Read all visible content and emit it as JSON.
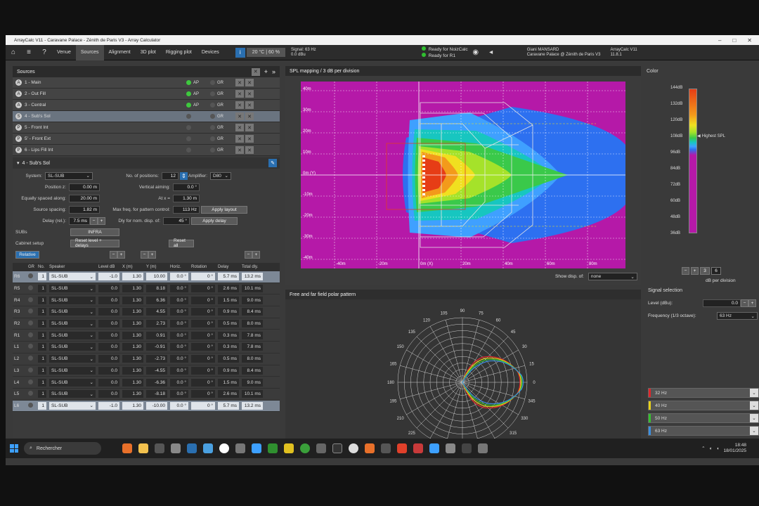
{
  "window": {
    "title": "ArrayCalc V11 - Caravane Palace - Zénith de Paris V3 - Array Calculator"
  },
  "toolbar": {
    "tabs": [
      "Venue",
      "Sources",
      "Alignment",
      "3D plot",
      "Rigging plot",
      "Devices"
    ],
    "active_tab": "Sources",
    "temperature": "20 °C | 60 %",
    "signal_line1": "Signal: 63 Hz",
    "signal_line2": "0.0 dBu",
    "status1": "Ready for NoizCalc",
    "status2": "Ready for R1",
    "user_line1": "Giani MANSARD",
    "user_line2": "Caravane Palace @ Zénith de Paris V3",
    "version_line1": "ArrayCalc V11",
    "version_line2": "11.8.1"
  },
  "sources": {
    "title": "Sources",
    "items": [
      {
        "letter": "A",
        "name": "1 - Main",
        "ap": true,
        "ap_label": "AP",
        "gr_label": "GR"
      },
      {
        "letter": "A",
        "name": "2 - Out Fill",
        "ap": true,
        "ap_label": "AP",
        "gr_label": "GR"
      },
      {
        "letter": "A",
        "name": "3 - Central",
        "ap": true,
        "ap_label": "AP",
        "gr_label": "GR"
      },
      {
        "letter": "S",
        "name": "4 - Sub's Sol",
        "ap": false,
        "ap_label": "",
        "gr_label": "GR"
      },
      {
        "letter": "P",
        "name": "5 - Front Int",
        "ap": false,
        "ap_label": "",
        "gr_label": "GR"
      },
      {
        "letter": "P",
        "name": "5' - Front Ext",
        "ap": false,
        "ap_label": "",
        "gr_label": "GR"
      },
      {
        "letter": "P",
        "name": "6 - Lips Fill Int",
        "ap": false,
        "ap_label": "",
        "gr_label": "GR"
      }
    ]
  },
  "sub": {
    "title": "4 - Sub's Sol",
    "system_label": "System:",
    "system_value": "SL-SUB",
    "positions_label": "No. of positions:",
    "positions_value": "12",
    "amplifier_label": "Amplifier:",
    "amplifier_value": "D80",
    "posz_label": "Position z:",
    "posz_value": "0.00 m",
    "vaim_label": "Vertical aiming:",
    "vaim_value": "0.0 °",
    "spaced_label": "Equally spaced along:",
    "spaced_value": "20.00 m",
    "atx_label": "At x =",
    "atx_value": "1.30 m",
    "spacing_label": "Source spacing:",
    "spacing_value": "1.82 m",
    "maxfreq_label": "Max freq. for pattern control:",
    "maxfreq_value": "113 Hz",
    "apply_layout": "Apply layout",
    "delay_label": "Delay (rel.):",
    "delay_value": "7.5 ms",
    "dly_label": "Dly for nom. disp. of:",
    "dly_value": "45 °",
    "apply_delay": "Apply delay",
    "subs_label": "SUBs",
    "infra_label": "INFRA",
    "cabinet_label": "Cabinet setup",
    "reset_level": "Reset level + delays",
    "reset_all": "Reset all",
    "relative_label": "Relative"
  },
  "table": {
    "headers": [
      "",
      "GR",
      "No.",
      "Speaker",
      "Level dB",
      "X (m)",
      "Y (m)",
      "Horiz.",
      "Rotation",
      "Delay",
      "Total dly."
    ],
    "rows": [
      {
        "id": "R6",
        "no": "1",
        "speaker": "SL-SUB",
        "level": "-1.0",
        "x": "1.30",
        "y": "10.00",
        "horiz": "0.0 °",
        "rot": "0 °",
        "delay": "5.7 ms",
        "total": "13.2 ms",
        "hl": true
      },
      {
        "id": "R5",
        "no": "1",
        "speaker": "SL-SUB",
        "level": "0.0",
        "x": "1.30",
        "y": "8.18",
        "horiz": "0.0 °",
        "rot": "0 °",
        "delay": "2.6 ms",
        "total": "10.1 ms",
        "hl": false
      },
      {
        "id": "R4",
        "no": "1",
        "speaker": "SL-SUB",
        "level": "0.0",
        "x": "1.30",
        "y": "6.36",
        "horiz": "0.0 °",
        "rot": "0 °",
        "delay": "1.5 ms",
        "total": "9.0 ms",
        "hl": false
      },
      {
        "id": "R3",
        "no": "1",
        "speaker": "SL-SUB",
        "level": "0.0",
        "x": "1.30",
        "y": "4.55",
        "horiz": "0.0 °",
        "rot": "0 °",
        "delay": "0.9 ms",
        "total": "8.4 ms",
        "hl": false
      },
      {
        "id": "R2",
        "no": "1",
        "speaker": "SL-SUB",
        "level": "0.0",
        "x": "1.30",
        "y": "2.73",
        "horiz": "0.0 °",
        "rot": "0 °",
        "delay": "0.5 ms",
        "total": "8.0 ms",
        "hl": false
      },
      {
        "id": "R1",
        "no": "1",
        "speaker": "SL-SUB",
        "level": "0.0",
        "x": "1.30",
        "y": "0.91",
        "horiz": "0.0 °",
        "rot": "0 °",
        "delay": "0.3 ms",
        "total": "7.8 ms",
        "hl": false
      },
      {
        "id": "L1",
        "no": "1",
        "speaker": "SL-SUB",
        "level": "0.0",
        "x": "1.30",
        "y": "-0.91",
        "horiz": "0.0 °",
        "rot": "0 °",
        "delay": "0.3 ms",
        "total": "7.8 ms",
        "hl": false
      },
      {
        "id": "L2",
        "no": "1",
        "speaker": "SL-SUB",
        "level": "0.0",
        "x": "1.30",
        "y": "-2.73",
        "horiz": "0.0 °",
        "rot": "0 °",
        "delay": "0.5 ms",
        "total": "8.0 ms",
        "hl": false
      },
      {
        "id": "L3",
        "no": "1",
        "speaker": "SL-SUB",
        "level": "0.0",
        "x": "1.30",
        "y": "-4.55",
        "horiz": "0.0 °",
        "rot": "0 °",
        "delay": "0.9 ms",
        "total": "8.4 ms",
        "hl": false
      },
      {
        "id": "L4",
        "no": "1",
        "speaker": "SL-SUB",
        "level": "0.0",
        "x": "1.30",
        "y": "-6.36",
        "horiz": "0.0 °",
        "rot": "0 °",
        "delay": "1.5 ms",
        "total": "9.0 ms",
        "hl": false
      },
      {
        "id": "L5",
        "no": "1",
        "speaker": "SL-SUB",
        "level": "0.0",
        "x": "1.30",
        "y": "-8.18",
        "horiz": "0.0 °",
        "rot": "0 °",
        "delay": "2.6 ms",
        "total": "10.1 ms",
        "hl": false
      },
      {
        "id": "L6",
        "no": "1",
        "speaker": "SL-SUB",
        "level": "-1.0",
        "x": "1.30",
        "y": "-10.00",
        "horiz": "0.0 °",
        "rot": "0 °",
        "delay": "5.7 ms",
        "total": "13.2 ms",
        "hl": true
      }
    ]
  },
  "spl": {
    "title": "SPL mapping / 3 dB per division",
    "y_labels": [
      "40m",
      "30m",
      "20m",
      "10m",
      "0m (Y)",
      "-10m",
      "-20m",
      "-30m",
      "-40m"
    ],
    "x_labels": [
      "-40m",
      "-20m",
      "0m (X)",
      "20m",
      "40m",
      "60m",
      "80m"
    ],
    "show_disp_label": "Show disp. of:",
    "show_disp_value": "none"
  },
  "colorbar": {
    "title": "Color",
    "labels": [
      "144dB",
      "132dB",
      "120dB",
      "108dB",
      "96dB",
      "84dB",
      "72dB",
      "60dB",
      "48dB",
      "36dB"
    ],
    "highest_label": "Highest SPL",
    "step_a": "3",
    "step_b": "6",
    "per_div": "dB per division"
  },
  "signal": {
    "title": "Signal selection",
    "level_label": "Level (dBu):",
    "level_value": "0.0",
    "freq_label": "Frequency (1/3 octave):",
    "freq_value": "63 Hz"
  },
  "polar": {
    "title": "Free and far field polar pattern",
    "angles": [
      "90",
      "75",
      "60",
      "45",
      "30",
      "15",
      "0",
      "345",
      "330",
      "315",
      "300",
      "285",
      "270",
      "255",
      "240",
      "225",
      "210",
      "195",
      "180",
      "165",
      "150",
      "135",
      "120",
      "105"
    ]
  },
  "freqs": [
    {
      "label": "32 Hz",
      "color": "#e0262b"
    },
    {
      "label": "40 Hz",
      "color": "#e8d11a"
    },
    {
      "label": "50 Hz",
      "color": "#35c12e"
    },
    {
      "label": "63 Hz",
      "color": "#3c8fe0"
    }
  ],
  "taskbar": {
    "search_label": "Rechercher",
    "time": "18:48",
    "date": "18/01/2025"
  }
}
